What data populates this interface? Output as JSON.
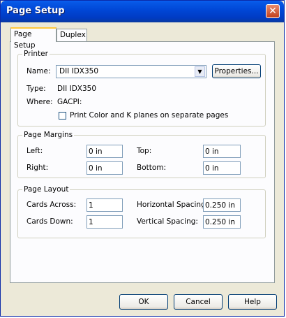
{
  "window": {
    "title": "Page Setup"
  },
  "tabs": [
    {
      "label": "Page Setup",
      "active": true
    },
    {
      "label": "Duplex",
      "active": false
    }
  ],
  "printer": {
    "group_title": "Printer",
    "name_label": "Name:",
    "name_value": "DII IDX350",
    "properties_button": "Properties...",
    "type_label": "Type:",
    "type_value": "DII IDX350",
    "where_label": "Where:",
    "where_value": "GACPI:",
    "separate_planes_label": "Print Color and K planes on separate pages",
    "separate_planes_checked": false
  },
  "margins": {
    "group_title": "Page Margins",
    "left_label": "Left:",
    "left_value": "0 in",
    "top_label": "Top:",
    "top_value": "0 in",
    "right_label": "Right:",
    "right_value": "0 in",
    "bottom_label": "Bottom:",
    "bottom_value": "0 in"
  },
  "layout": {
    "group_title": "Page Layout",
    "cards_across_label": "Cards Across:",
    "cards_across_value": "1",
    "cards_down_label": "Cards Down:",
    "cards_down_value": "1",
    "h_spacing_label": "Horizontal Spacing:",
    "h_spacing_value": "0.250 in",
    "v_spacing_label": "Vertical Spacing:",
    "v_spacing_value": "0.250 in"
  },
  "buttons": {
    "ok": "OK",
    "cancel": "Cancel",
    "help": "Help"
  },
  "icons": {
    "close": "close-icon",
    "dropdown": "chevron-down-icon"
  },
  "colors": {
    "titlebar": "#0046d5",
    "close": "#c2411d",
    "active_tab_accent": "#ffc83c"
  }
}
